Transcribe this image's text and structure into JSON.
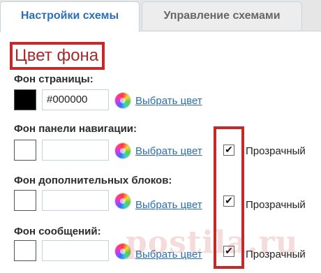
{
  "tabs": [
    {
      "label": "Настройки схемы",
      "active": true
    },
    {
      "label": "Управление схемами",
      "active": false
    }
  ],
  "section_title": "Цвет фона",
  "fields": [
    {
      "label": "Фон страницы:",
      "hex": "#000000",
      "swatch_color": "#000000",
      "pick_link": "Выбрать цвет",
      "transparent_label": null,
      "transparent_checked": null
    },
    {
      "label": "Фон панели навигации:",
      "hex": "",
      "swatch_color": "#ffffff",
      "pick_link": "Выбрать цвет",
      "transparent_label": "Прозрачный",
      "transparent_checked": true
    },
    {
      "label": "Фон дополнительных блоков:",
      "hex": "",
      "swatch_color": "#ffffff",
      "pick_link": "Выбрать цвет",
      "transparent_label": "Прозрачный",
      "transparent_checked": true
    },
    {
      "label": "Фон сообщений:",
      "hex": "",
      "swatch_color": "#ffffff",
      "pick_link": "Выбрать цвет",
      "transparent_label": "Прозрачный",
      "transparent_checked": true
    }
  ],
  "watermark": "postila.ru",
  "colors": {
    "accent": "#2a6fb3",
    "highlight": "#c52a2a"
  },
  "icons": {
    "color_picker": "color-wheel-icon",
    "check": "✔"
  }
}
